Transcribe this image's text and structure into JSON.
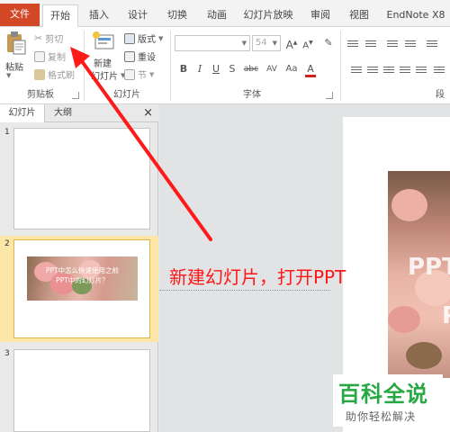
{
  "tabs": [
    {
      "label": "文件"
    },
    {
      "label": "开始"
    },
    {
      "label": "插入"
    },
    {
      "label": "设计"
    },
    {
      "label": "切换"
    },
    {
      "label": "动画"
    },
    {
      "label": "幻灯片放映"
    },
    {
      "label": "审阅"
    },
    {
      "label": "视图"
    },
    {
      "label": "EndNote X8"
    }
  ],
  "clipboard": {
    "paste": "粘贴",
    "cut": "剪切",
    "copy": "复制",
    "format_painter": "格式刷",
    "group_label": "剪贴板"
  },
  "slides_group": {
    "new_slide_line1": "新建",
    "new_slide_line2": "幻灯片",
    "layout": "版式",
    "reset": "重设",
    "section": "节",
    "group_label": "幻灯片"
  },
  "font_group": {
    "font_size": "54",
    "bold": "B",
    "italic": "I",
    "underline": "U",
    "strike": "S",
    "shadow": "abc",
    "spacing": "AV",
    "case": "Aa",
    "color": "A",
    "grow": "A",
    "shrink": "A",
    "group_label": "字体"
  },
  "paragraph_group": {
    "group_label": "段"
  },
  "pane": {
    "tab_slides": "幻灯片",
    "tab_outline": "大纲",
    "close": "×",
    "slides": [
      {
        "number": "1"
      },
      {
        "number": "2",
        "title_line1": "PPT中怎么快速使用之前",
        "title_line2": "PPT中的幻灯片？"
      },
      {
        "number": "3"
      }
    ]
  },
  "main_slide": {
    "big_text_1": "PPT",
    "big_text_2": "P"
  },
  "annotation": {
    "caption": "新建幻灯片，打开PPT"
  },
  "watermark": {
    "brand": "百科全说",
    "slogan": "助你轻松解决"
  },
  "colors": {
    "file_tab": "#d24726",
    "selected_slide": "#fce7a8",
    "annotation_red": "#ff1616",
    "watermark_green": "#28a745"
  }
}
